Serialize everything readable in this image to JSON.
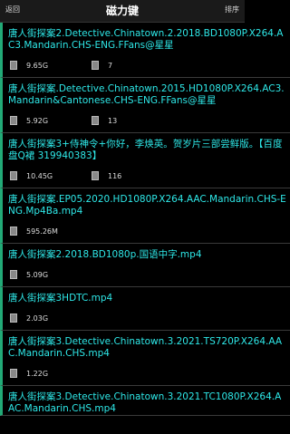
{
  "header": {
    "back_label": "返回",
    "title": "磁力键",
    "sort_label": "排序"
  },
  "results": [
    {
      "name": "唐人街探案2.Detective.Chinatown.2.2018.BD1080P.X264.AC3.Mandarin.CHS-ENG.FFans@星星",
      "size": "9.65G",
      "files": "7"
    },
    {
      "name": "唐人街探案.Detective.Chinatown.2015.HD1080P.X264.AC3.Mandarin&Cantonese.CHS-ENG.FFans@星星",
      "size": "5.92G",
      "files": "13"
    },
    {
      "name": "唐人街探案3+侍神令+你好，李焕英。贺岁片三部尝鲜版。【百度盘Q裙 319940383】",
      "size": "10.45G",
      "files": "116"
    },
    {
      "name": "唐人街探案.EP05.2020.HD1080P.X264.AAC.Mandarin.CHS-ENG.Mp4Ba.mp4",
      "size": "595.26M",
      "files": ""
    },
    {
      "name": "唐人街探案2.2018.BD1080p.国语中字.mp4",
      "size": "5.09G",
      "files": ""
    },
    {
      "name": "唐人街探案3HDTC.mp4",
      "size": "2.03G",
      "files": ""
    },
    {
      "name": "唐人街探案3.Detective.Chinatown.3.2021.TS720P.X264.AAC.Mandarin.CHS.mp4",
      "size": "1.22G",
      "files": ""
    },
    {
      "name": "唐人街探案3.Detective.Chinatown.3.2021.TC1080P.X264.AAC.Mandarin.CHS.mp4",
      "size": "",
      "files": ""
    }
  ]
}
